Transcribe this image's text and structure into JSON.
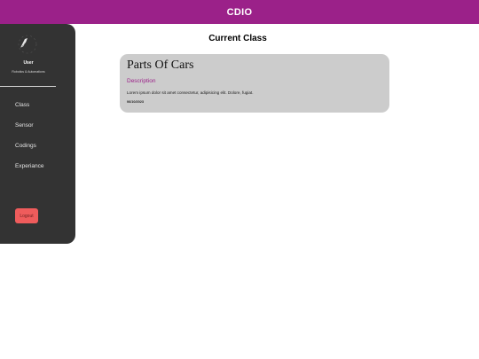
{
  "header": {
    "title": "CDIO"
  },
  "sidebar": {
    "avatar_icon": "user-avatar-icon",
    "user_name": "User",
    "user_role": "Robotics & Automations",
    "items": [
      {
        "label": "Class"
      },
      {
        "label": "Sensor"
      },
      {
        "label": "Codings"
      },
      {
        "label": "Experiance"
      }
    ],
    "logout_label": "Logout"
  },
  "main": {
    "section_title": "Current Class",
    "card": {
      "title": "Parts Of Cars",
      "description_label": "Description",
      "description": "Lorem ipsum dolor sit amet consectetur, adipisicing elit. Dolore, fugiat.",
      "date": "06/10/2023"
    }
  },
  "colors": {
    "header_bg": "#9b2189",
    "sidebar_bg": "#333333",
    "card_bg": "#cccccc",
    "accent": "#9b2189",
    "logout_bg": "#ef5c5c"
  }
}
